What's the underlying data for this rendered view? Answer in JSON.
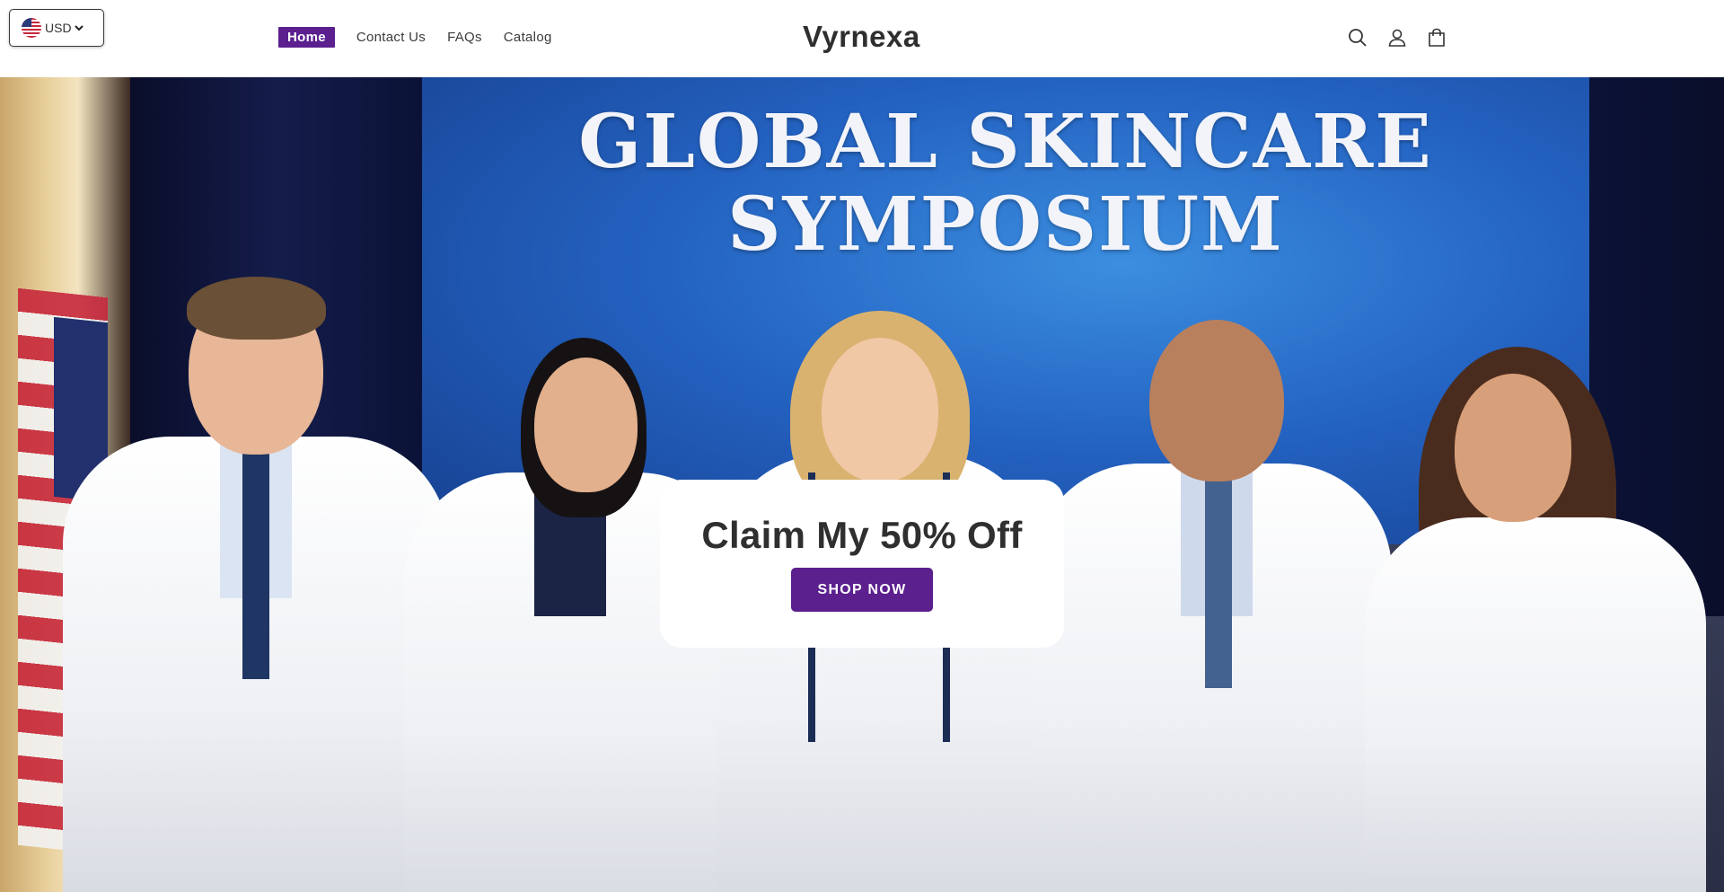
{
  "header": {
    "currency": {
      "code": "USD",
      "flag": "us-flag-icon"
    },
    "nav": [
      {
        "label": "Home",
        "active": true
      },
      {
        "label": "Contact Us",
        "active": false
      },
      {
        "label": "FAQs",
        "active": false
      },
      {
        "label": "Catalog",
        "active": false
      }
    ],
    "brand": "Vyrnexa",
    "icons": [
      "search-icon",
      "account-icon",
      "cart-icon"
    ],
    "accent_color": "#5b1f8e"
  },
  "hero": {
    "screen_title_line1": "GLOBAL SKINCARE",
    "screen_title_line2": "SYMPOSIUM",
    "promo_title": "Claim My 50% Off",
    "cta_label": "SHOP NOW"
  }
}
